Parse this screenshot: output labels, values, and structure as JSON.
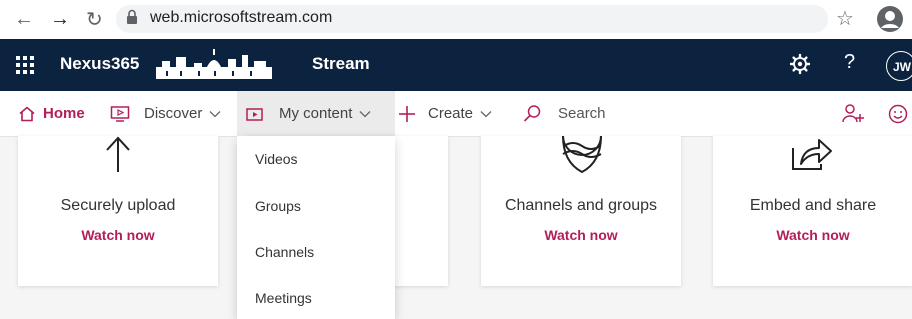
{
  "browser": {
    "url": "web.microsoftstream.com"
  },
  "header": {
    "org_name": "Nexus365",
    "app_name": "Stream",
    "avatar_initials": "JW"
  },
  "nav": {
    "home": "Home",
    "discover": "Discover",
    "my_content": "My content",
    "create": "Create",
    "search_placeholder": "Search"
  },
  "dropdown": {
    "items": [
      "Videos",
      "Groups",
      "Channels",
      "Meetings"
    ]
  },
  "cards": [
    {
      "title": "Securely upload",
      "link": "Watch now",
      "icon": "upload-arrow-icon"
    },
    {
      "title": "Channels and groups",
      "link": "Watch now",
      "icon": "channels-globe-icon"
    },
    {
      "title": "Embed and share",
      "link": "Watch now",
      "icon": "share-icon"
    }
  ],
  "colors": {
    "header_bg": "#0c2340",
    "accent": "#b31e5a",
    "page_bg": "#f5f5f5"
  }
}
